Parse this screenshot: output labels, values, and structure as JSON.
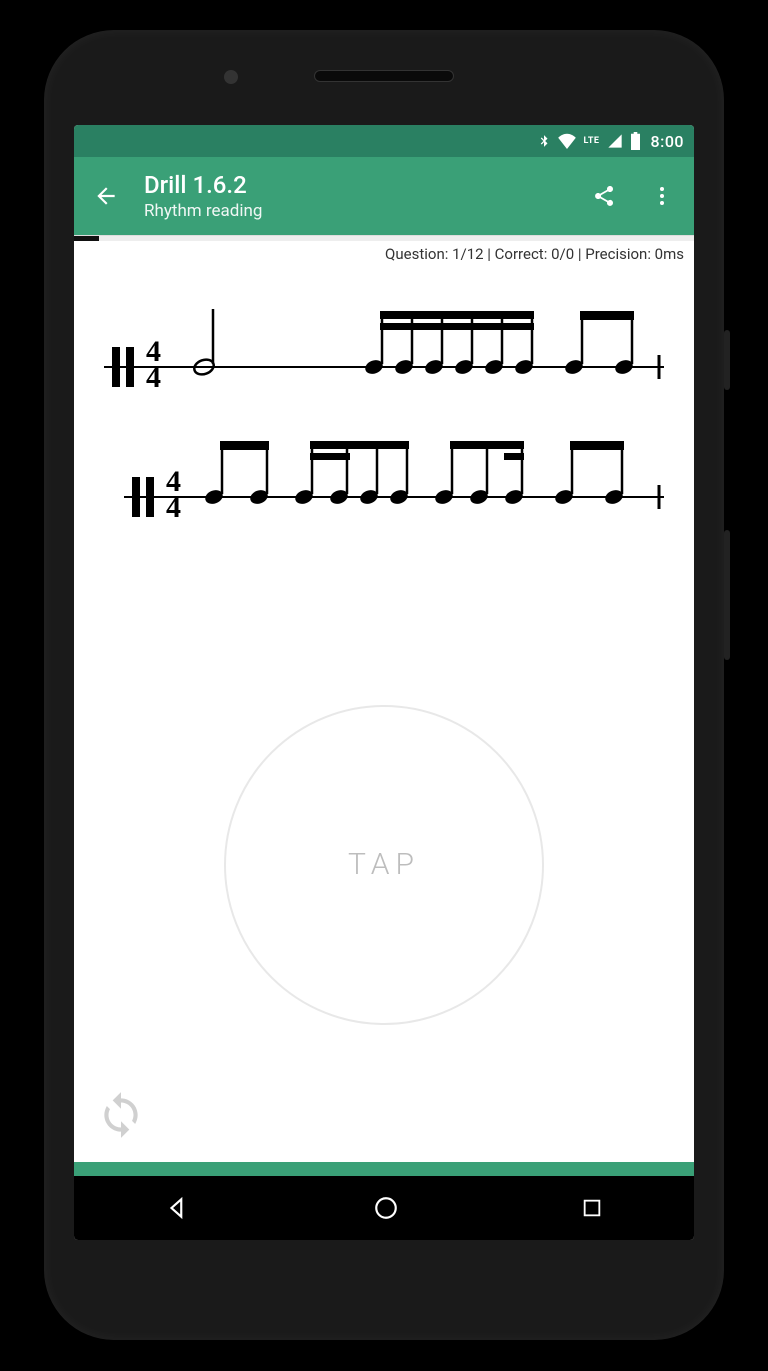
{
  "status": {
    "clock": "8:00",
    "lte": "LTE"
  },
  "appbar": {
    "title": "Drill 1.6.2",
    "subtitle": "Rhythm reading"
  },
  "stats": {
    "question_label": "Question:",
    "question_value": "1/12",
    "correct_label": "Correct:",
    "correct_value": "0/0",
    "precision_label": "Precision:",
    "precision_value": "0ms",
    "full_text": "Question: 1/12 | Correct: 0/0 | Precision: 0ms"
  },
  "progress_percent": 4,
  "tap": {
    "label": "TAP"
  },
  "notation": {
    "time_signature": "4/4",
    "bars": [
      {
        "notes": [
          "half",
          "sixteenth-group-4",
          "eighth-pair"
        ]
      },
      {
        "notes": [
          "eighth-pair",
          "sixteenth-eighth-mix",
          "sixteenth-eighth-mix",
          "eighth-pair"
        ]
      }
    ]
  },
  "colors": {
    "accent": "#3aa077",
    "accent_dark": "#2a8062"
  }
}
